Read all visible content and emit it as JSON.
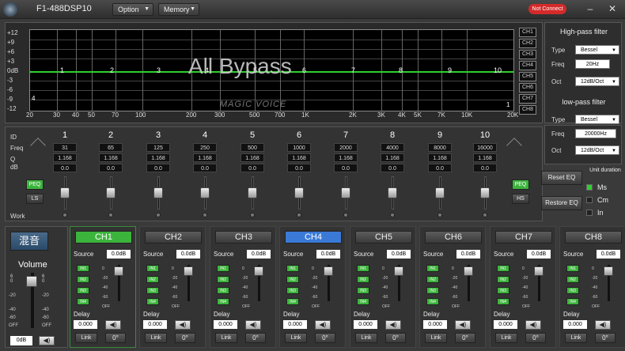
{
  "app": {
    "title": "F1-488DSP10",
    "status": "Not Connect"
  },
  "menu": [
    {
      "label": "Option"
    },
    {
      "label": "Memory"
    }
  ],
  "graph": {
    "y_labels": [
      "+12",
      "+9",
      "+6",
      "+3",
      "0dB",
      "-3",
      "-6",
      "-9",
      "-12"
    ],
    "x_labels": [
      "20",
      "30",
      "40",
      "50",
      "70",
      "100",
      "200",
      "300",
      "500",
      "700",
      "1K",
      "2K",
      "3K",
      "4K",
      "5K",
      "7K",
      "10K",
      "20K"
    ],
    "band_points": [
      "1",
      "2",
      "3",
      "4",
      "5",
      "6",
      "7",
      "8",
      "9",
      "10"
    ],
    "bypass_text": "All Bypass",
    "watermark": "MAGIC VOICE",
    "side_markers": [
      "4",
      "1"
    ],
    "channels": [
      "CH1",
      "CH2",
      "CH3",
      "CH4",
      "CH5",
      "CH6",
      "CH7",
      "CH8"
    ],
    "eq_line_color": "#2fcf2f"
  },
  "highpass": {
    "title": "High-pass filter",
    "type_label": "Type",
    "type": "Bessel",
    "freq_label": "Freq",
    "freq": "20Hz",
    "oct_label": "Oct",
    "oct": "12dB/Oct"
  },
  "lowpass": {
    "title": "low-pass filter",
    "type_label": "Type",
    "type": "Bessel",
    "freq_label": "Freq",
    "freq": "20000Hz",
    "oct_label": "Oct",
    "oct": "12dB/Oct"
  },
  "eq": {
    "row_labels": {
      "id": "ID",
      "freq": "Freq",
      "q": "Q",
      "db": "dB",
      "work": "Work"
    },
    "bands": [
      {
        "id": "1",
        "freq": "31",
        "q": "1.168",
        "db": "0.0"
      },
      {
        "id": "2",
        "freq": "65",
        "q": "1.168",
        "db": "0.0"
      },
      {
        "id": "3",
        "freq": "125",
        "q": "1.168",
        "db": "0.0"
      },
      {
        "id": "4",
        "freq": "250",
        "q": "1.168",
        "db": "0.0"
      },
      {
        "id": "5",
        "freq": "500",
        "q": "1.168",
        "db": "0.0"
      },
      {
        "id": "6",
        "freq": "1000",
        "q": "1.168",
        "db": "0.0"
      },
      {
        "id": "7",
        "freq": "2000",
        "q": "1.168",
        "db": "0.0"
      },
      {
        "id": "8",
        "freq": "4000",
        "q": "1.168",
        "db": "0.0"
      },
      {
        "id": "9",
        "freq": "8000",
        "q": "1.168",
        "db": "0.0"
      },
      {
        "id": "10",
        "freq": "16000",
        "q": "1.168",
        "db": "0.0"
      }
    ],
    "left_peq": "PEQ",
    "left_ls": "LS",
    "right_peq": "PEQ",
    "right_hs": "HS",
    "reset": "Reset EQ",
    "restore": "Restore EQ"
  },
  "unit": {
    "title": "Unit duration",
    "options": [
      "Ms",
      "Cm",
      "In"
    ],
    "selected": "Ms"
  },
  "mix": {
    "label": "混音",
    "volume_title": "Volume",
    "value": "0dB",
    "scale": [
      "6",
      "0",
      "-20",
      "-40",
      "-60",
      "OFF"
    ]
  },
  "channels": [
    {
      "name": "CH1",
      "source_label": "Source",
      "source": "0.0dB",
      "inputs": [
        "IN1",
        "IN2",
        "IN3",
        "IN4"
      ],
      "delay_label": "Delay",
      "delay": "0.000",
      "link": "Link",
      "phase": "0°"
    },
    {
      "name": "CH2",
      "source_label": "Source",
      "source": "0.0dB",
      "inputs": [
        "IN1",
        "IN2",
        "IN3",
        "IN4"
      ],
      "delay_label": "Delay",
      "delay": "0.000",
      "link": "Link",
      "phase": "0°"
    },
    {
      "name": "CH3",
      "source_label": "Source",
      "source": "0.0dB",
      "inputs": [
        "IN1",
        "IN2",
        "IN3",
        "IN4"
      ],
      "delay_label": "Delay",
      "delay": "0.000",
      "link": "Link",
      "phase": "0°"
    },
    {
      "name": "CH4",
      "source_label": "Source",
      "source": "0.0dB",
      "inputs": [
        "IN1",
        "IN2",
        "IN3",
        "IN4"
      ],
      "delay_label": "Delay",
      "delay": "0.000",
      "link": "Link",
      "phase": "0°"
    },
    {
      "name": "CH5",
      "source_label": "Source",
      "source": "0.0dB",
      "inputs": [
        "IN1",
        "IN2",
        "IN3",
        "IN4"
      ],
      "delay_label": "Delay",
      "delay": "0.000",
      "link": "Link",
      "phase": "0°"
    },
    {
      "name": "CH6",
      "source_label": "Source",
      "source": "0.0dB",
      "inputs": [
        "IN1",
        "IN2",
        "IN3",
        "IN4"
      ],
      "delay_label": "Delay",
      "delay": "0.000",
      "link": "Link",
      "phase": "0°"
    },
    {
      "name": "CH7",
      "source_label": "Source",
      "source": "0.0dB",
      "inputs": [
        "IN1",
        "IN2",
        "IN3",
        "IN4"
      ],
      "delay_label": "Delay",
      "delay": "0.000",
      "link": "Link",
      "phase": "0°"
    },
    {
      "name": "CH8",
      "source_label": "Source",
      "source": "0.0dB",
      "inputs": [
        "IN1",
        "IN2",
        "IN3",
        "IN4"
      ],
      "delay_label": "Delay",
      "delay": "0.000",
      "link": "Link",
      "phase": "0°"
    }
  ],
  "channel_scale": [
    "0",
    "-20",
    "-40",
    "-60",
    "OFF"
  ],
  "colors": {
    "active": "#3cb43c",
    "selected_channel": "#3a7ad6",
    "alert": "#d42a2a"
  }
}
